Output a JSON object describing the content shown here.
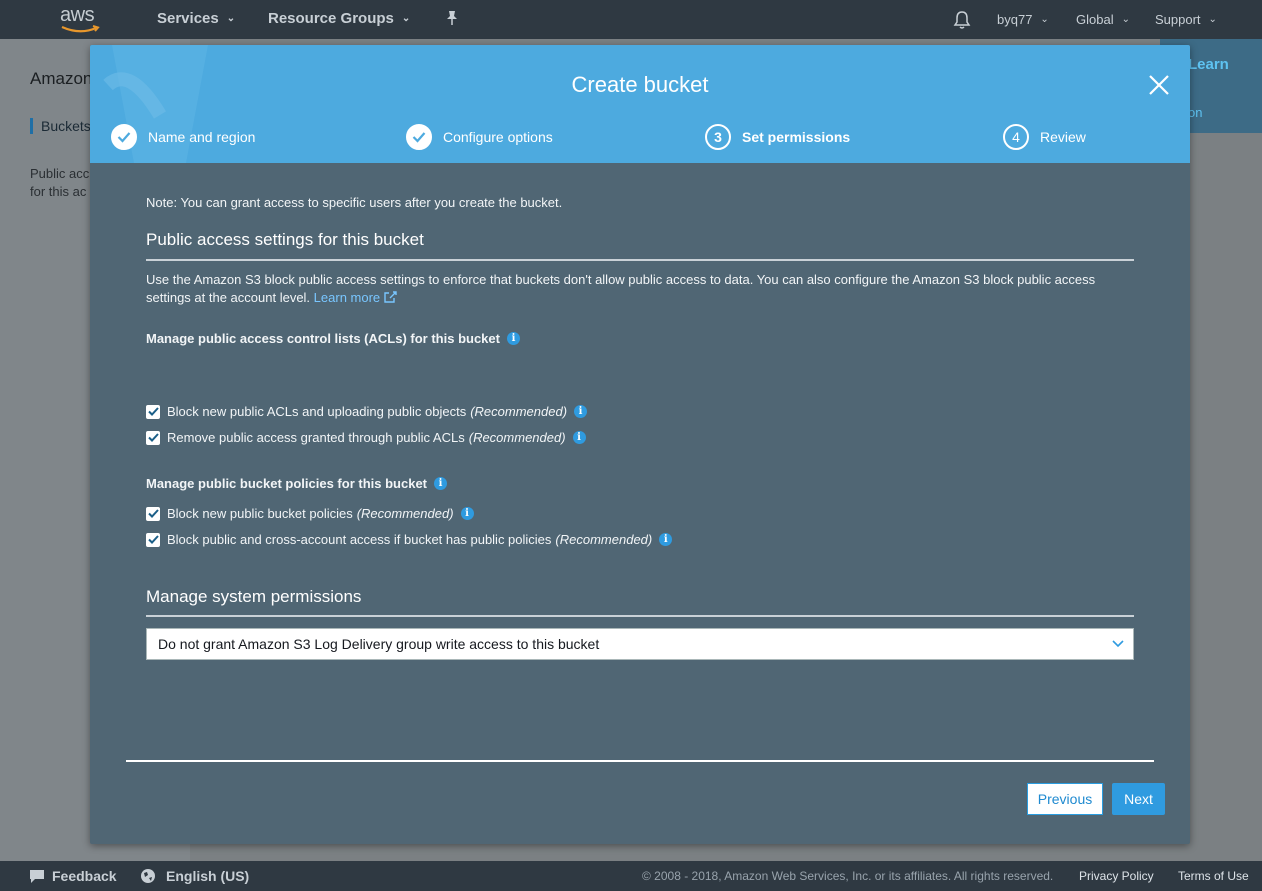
{
  "nav": {
    "logo": "aws",
    "services": "Services",
    "resource_groups": "Resource Groups",
    "user": "byq77",
    "region": "Global",
    "support": "Support"
  },
  "background": {
    "title": "Amazon",
    "buckets": "Buckets",
    "public_line1": "Public acc",
    "public_line2": "for this ac",
    "learn": "Learn",
    "on": "on"
  },
  "modal": {
    "title": "Create bucket",
    "steps": [
      {
        "label": "Name and region",
        "state": "done"
      },
      {
        "label": "Configure options",
        "state": "done"
      },
      {
        "label": "Set permissions",
        "number": "3",
        "state": "active"
      },
      {
        "label": "Review",
        "number": "4",
        "state": "pending"
      }
    ],
    "note": "Note: You can grant access to specific users after you create the bucket.",
    "public_access": {
      "heading": "Public access settings for this bucket",
      "description": "Use the Amazon S3 block public access settings to enforce that buckets don't allow public access to data. You can also configure the Amazon S3 block public access settings at the account level.",
      "learn_more": "Learn more",
      "acl_heading": "Manage public access control lists (ACLs) for this bucket",
      "acl_options": [
        {
          "label": "Block new public ACLs and uploading public objects",
          "tag": "(Recommended)",
          "checked": true
        },
        {
          "label": "Remove public access granted through public ACLs",
          "tag": "(Recommended)",
          "checked": true
        }
      ],
      "policy_heading": "Manage public bucket policies for this bucket",
      "policy_options": [
        {
          "label": "Block new public bucket policies",
          "tag": "(Recommended)",
          "checked": true
        },
        {
          "label": "Block public and cross-account access if bucket has public policies",
          "tag": "(Recommended)",
          "checked": true
        }
      ]
    },
    "system_permissions": {
      "heading": "Manage system permissions",
      "selected": "Do not grant Amazon S3 Log Delivery group write access to this bucket"
    },
    "buttons": {
      "previous": "Previous",
      "next": "Next"
    }
  },
  "footer": {
    "feedback": "Feedback",
    "language": "English (US)",
    "copyright": "© 2008 - 2018, Amazon Web Services, Inc. or its affiliates. All rights reserved.",
    "privacy": "Privacy Policy",
    "terms": "Terms of Use"
  },
  "colors": {
    "nav_bg": "#2f3942",
    "header_blue": "#4daadf",
    "modal_body": "#506674",
    "accent": "#2f9be0"
  }
}
